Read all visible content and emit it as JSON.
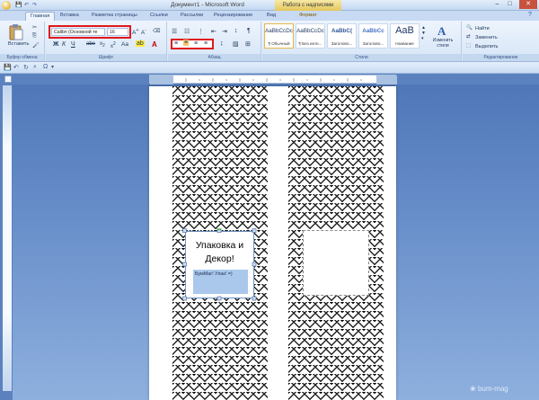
{
  "window": {
    "title": "Документ1 - Microsoft Word",
    "context_tab_group": "Работа с надписями"
  },
  "tabs": [
    {
      "label": "Главная"
    },
    {
      "label": "Вставка"
    },
    {
      "label": "Разметка страницы"
    },
    {
      "label": "Ссылки"
    },
    {
      "label": "Рассылки"
    },
    {
      "label": "Рецензирование"
    },
    {
      "label": "Вид"
    },
    {
      "label": "Формат"
    }
  ],
  "ribbon": {
    "clipboard": {
      "paste": "Вставить",
      "label": "Буфер обмена"
    },
    "font": {
      "family": "Calibri (Основной тe",
      "size": "16",
      "label": "Шрифт"
    },
    "paragraph": {
      "label": "Абзац"
    },
    "styles": {
      "items": [
        {
          "preview": "AaBbCcDc",
          "name": "¶ Обычный"
        },
        {
          "preview": "AaBbCcDc",
          "name": "¶ Без инте..."
        },
        {
          "preview": "AaBbC(",
          "name": "Заголово..."
        },
        {
          "preview": "AaBbCc",
          "name": "Заголово..."
        },
        {
          "preview": "AaB",
          "name": "Название"
        }
      ],
      "change": "Изменить стили",
      "label": "Стили"
    },
    "editing": {
      "find": "Найти",
      "replace": "Заменить",
      "select": "Выделить",
      "label": "Редактирование"
    }
  },
  "document": {
    "title_line1": "Упаковка и",
    "title_line2": "Декор!",
    "subtitle": "БумМаг! Упак! =)"
  },
  "watermark": "bum-mag",
  "colors": {
    "accent_red": "#e0171d",
    "workspace": "#5b82bf",
    "highlight": "#a9c8ec"
  }
}
